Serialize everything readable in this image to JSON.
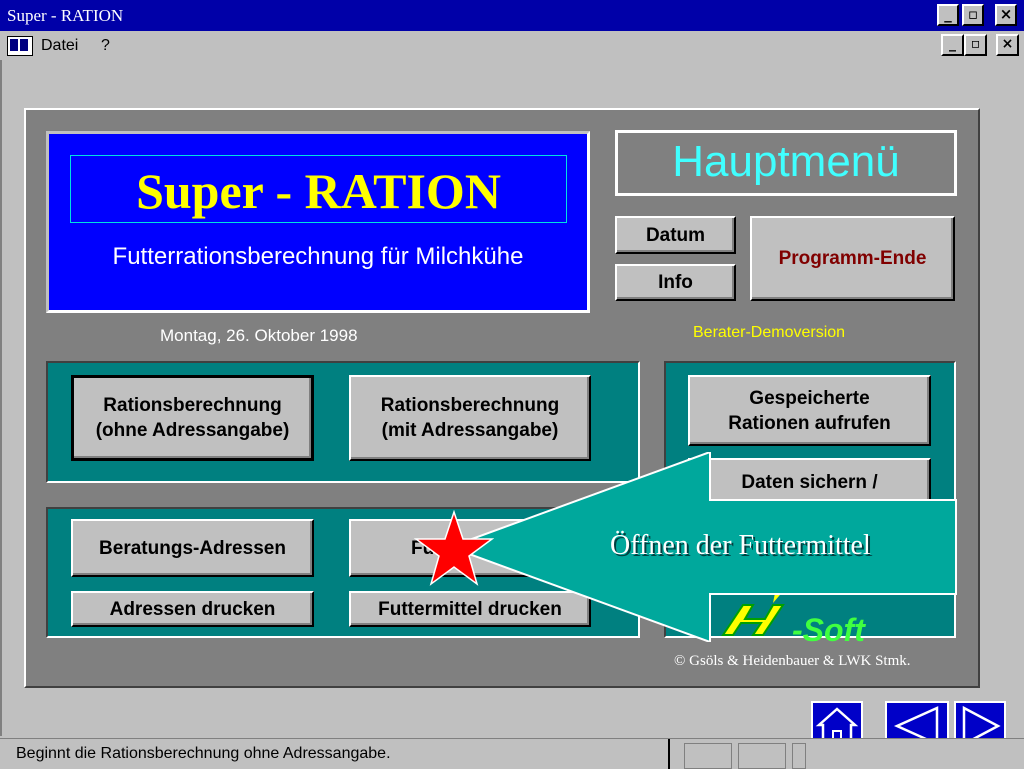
{
  "window": {
    "title": "Super - RATION"
  },
  "menu": {
    "datei": "Datei",
    "help": "?"
  },
  "header": {
    "app_title": "Super - RATION",
    "subtitle": "Futterrationsberechnung für Milchkühe",
    "menu_title": "Hauptmenü",
    "date": "Montag, 26. Oktober 1998",
    "demo": "Berater-Demoversion"
  },
  "buttons": {
    "datum": "Datum",
    "info": "Info",
    "programm_ende": "Programm-Ende",
    "ration_ohne_1": "Rationsberechnung",
    "ration_ohne_2": "(ohne Adressangabe)",
    "ration_mit_1": "Rationsberechnung",
    "ration_mit_2": "(mit Adressangabe)",
    "gespeicherte_1": "Gespeicherte",
    "gespeicherte_2": "Rationen aufrufen",
    "daten_sichern": "Daten sichern /",
    "beratungs": "Beratungs-Adressen",
    "futtermittel_partial": "Fu",
    "adressen_drucken": "Adressen drucken",
    "futtermittel_drucken": "Futtermittel drucken"
  },
  "callout": {
    "text": "Öffnen der Futtermittel"
  },
  "logo": {
    "text": "-Soft"
  },
  "copyright": "© Gsöls & Heidenbauer & LWK Stmk.",
  "status": {
    "text": "Beginnt die Rationsberechnung ohne Adressangabe."
  },
  "colors": {
    "title_bar": "#0000a8",
    "app_panel": "#0000ff",
    "teal": "#008080",
    "callout": "#00a89c",
    "star": "#ff0000"
  },
  "icons": {
    "home": "home-icon",
    "prev": "triangle-left-icon",
    "next": "triangle-right-icon"
  }
}
